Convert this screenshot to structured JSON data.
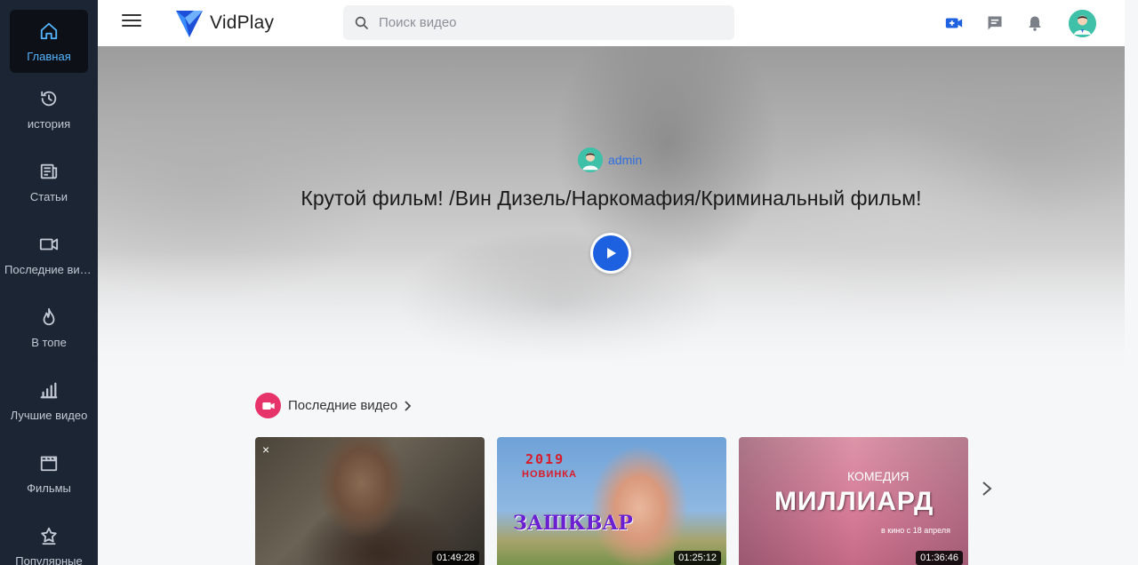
{
  "app": {
    "name": "VidPlay"
  },
  "sidebar": {
    "items": [
      {
        "label": "Главная",
        "icon": "home-icon",
        "active": true
      },
      {
        "label": "история",
        "icon": "history-icon"
      },
      {
        "label": "Статьи",
        "icon": "article-icon"
      },
      {
        "label": "Последние видео",
        "icon": "video-camera-icon"
      },
      {
        "label": "В топе",
        "icon": "flame-icon"
      },
      {
        "label": "Лучшие видео",
        "icon": "bar-chart-icon"
      },
      {
        "label": "Фильмы",
        "icon": "clapperboard-icon"
      },
      {
        "label": "Популярные",
        "icon": "star-badge-icon"
      }
    ]
  },
  "header": {
    "search_placeholder": "Поиск видео",
    "icons": [
      "add-video-icon",
      "messages-icon",
      "bell-icon",
      "user-avatar-icon"
    ]
  },
  "hero": {
    "author": "admin",
    "title": "Крутой фильм! /Вин Дизель/Наркомафия/Криминальный фильм!"
  },
  "section": {
    "title": "Последние видео"
  },
  "videos": [
    {
      "duration": "01:49:28",
      "close": "×"
    },
    {
      "duration": "01:25:12",
      "thumb_text": [
        "2019",
        "НОВИНКА",
        "ЗАШКВАР"
      ]
    },
    {
      "duration": "01:36:46",
      "thumb_text": [
        "КОМЕДИЯ",
        "МИЛЛИАРД",
        "в кино с 18 апреля"
      ]
    }
  ],
  "colors": {
    "sidebar_bg": "#1c2533",
    "accent_blue": "#1d61e0",
    "section_accent": "#e6336a",
    "active_nav_text": "#55b4ff"
  }
}
